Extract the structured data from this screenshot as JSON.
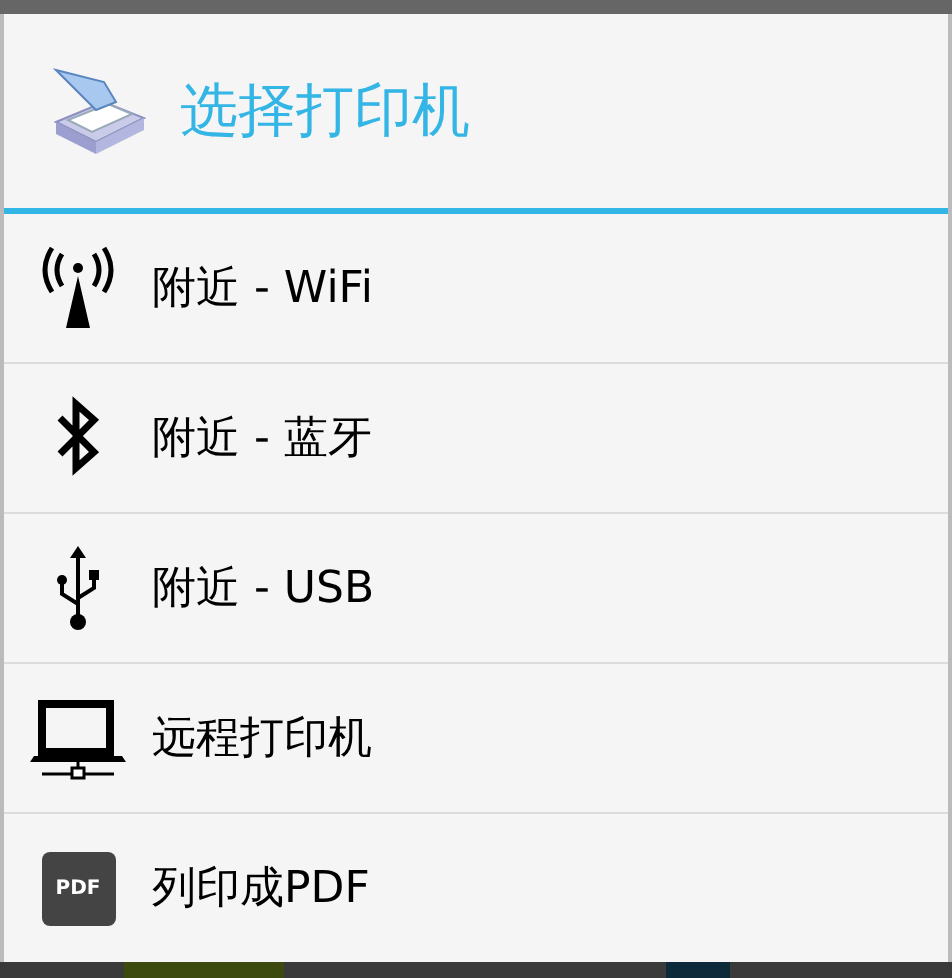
{
  "dialog": {
    "title": "选择打印机"
  },
  "options": [
    {
      "kind": "wifi",
      "label": "附近 - WiFi"
    },
    {
      "kind": "bluetooth",
      "label": "附近 - 蓝牙"
    },
    {
      "kind": "usb",
      "label": "附近 - USB"
    },
    {
      "kind": "remote",
      "label": "远程打印机"
    },
    {
      "kind": "pdf",
      "label": "列印成PDF",
      "icon_text": "PDF"
    }
  ]
}
